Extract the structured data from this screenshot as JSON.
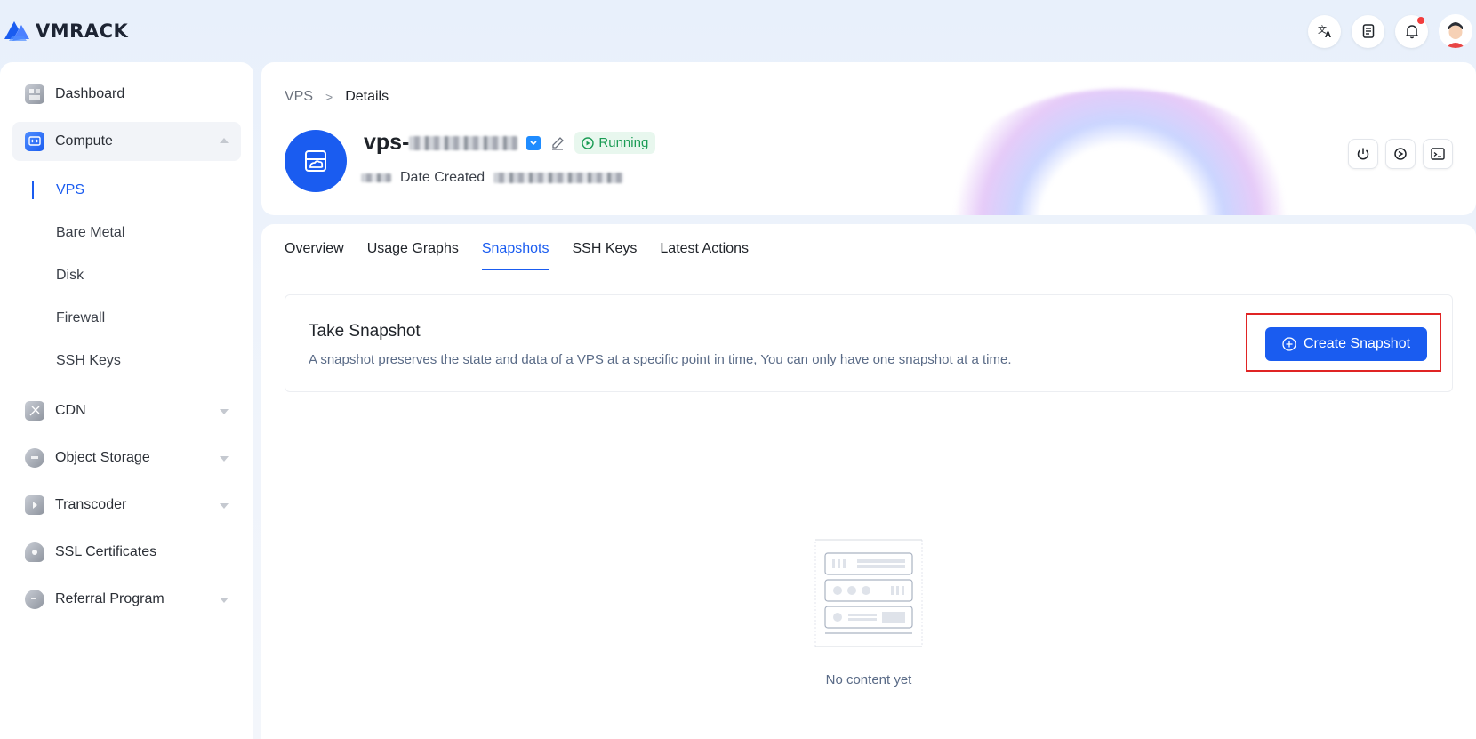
{
  "app": {
    "brand": "VMRACK",
    "brand_color": "#1a5cf0"
  },
  "topbar": {
    "icons": [
      "translate-icon",
      "document-icon",
      "bell-icon",
      "avatar"
    ]
  },
  "sidebar": {
    "items": [
      {
        "label": "Dashboard",
        "icon": "dashboard-icon"
      },
      {
        "label": "Compute",
        "icon": "compute-icon",
        "expanded": true
      },
      {
        "label": "CDN",
        "icon": "cdn-icon"
      },
      {
        "label": "Object Storage",
        "icon": "object-storage-icon"
      },
      {
        "label": "Transcoder",
        "icon": "transcoder-icon"
      },
      {
        "label": "SSL Certificates",
        "icon": "ssl-icon"
      },
      {
        "label": "Referral Program",
        "icon": "referral-icon"
      }
    ],
    "compute_sub": [
      "VPS",
      "Bare Metal",
      "Disk",
      "Firewall",
      "SSH Keys"
    ]
  },
  "breadcrumb": {
    "root": "VPS",
    "separator": ">",
    "current": "Details"
  },
  "vps": {
    "name_prefix": "vps-",
    "status": "Running",
    "date_label": "Date Created",
    "status_color": "#1b9c55"
  },
  "tabs": [
    "Overview",
    "Usage Graphs",
    "Snapshots",
    "SSH Keys",
    "Latest Actions"
  ],
  "snapshot": {
    "title": "Take Snapshot",
    "description": "A snapshot preserves the state and data of a VPS at a specific point in time, You can only have one snapshot at a time.",
    "create_button": "Create Snapshot"
  },
  "empty_state": {
    "text": "No content yet"
  }
}
